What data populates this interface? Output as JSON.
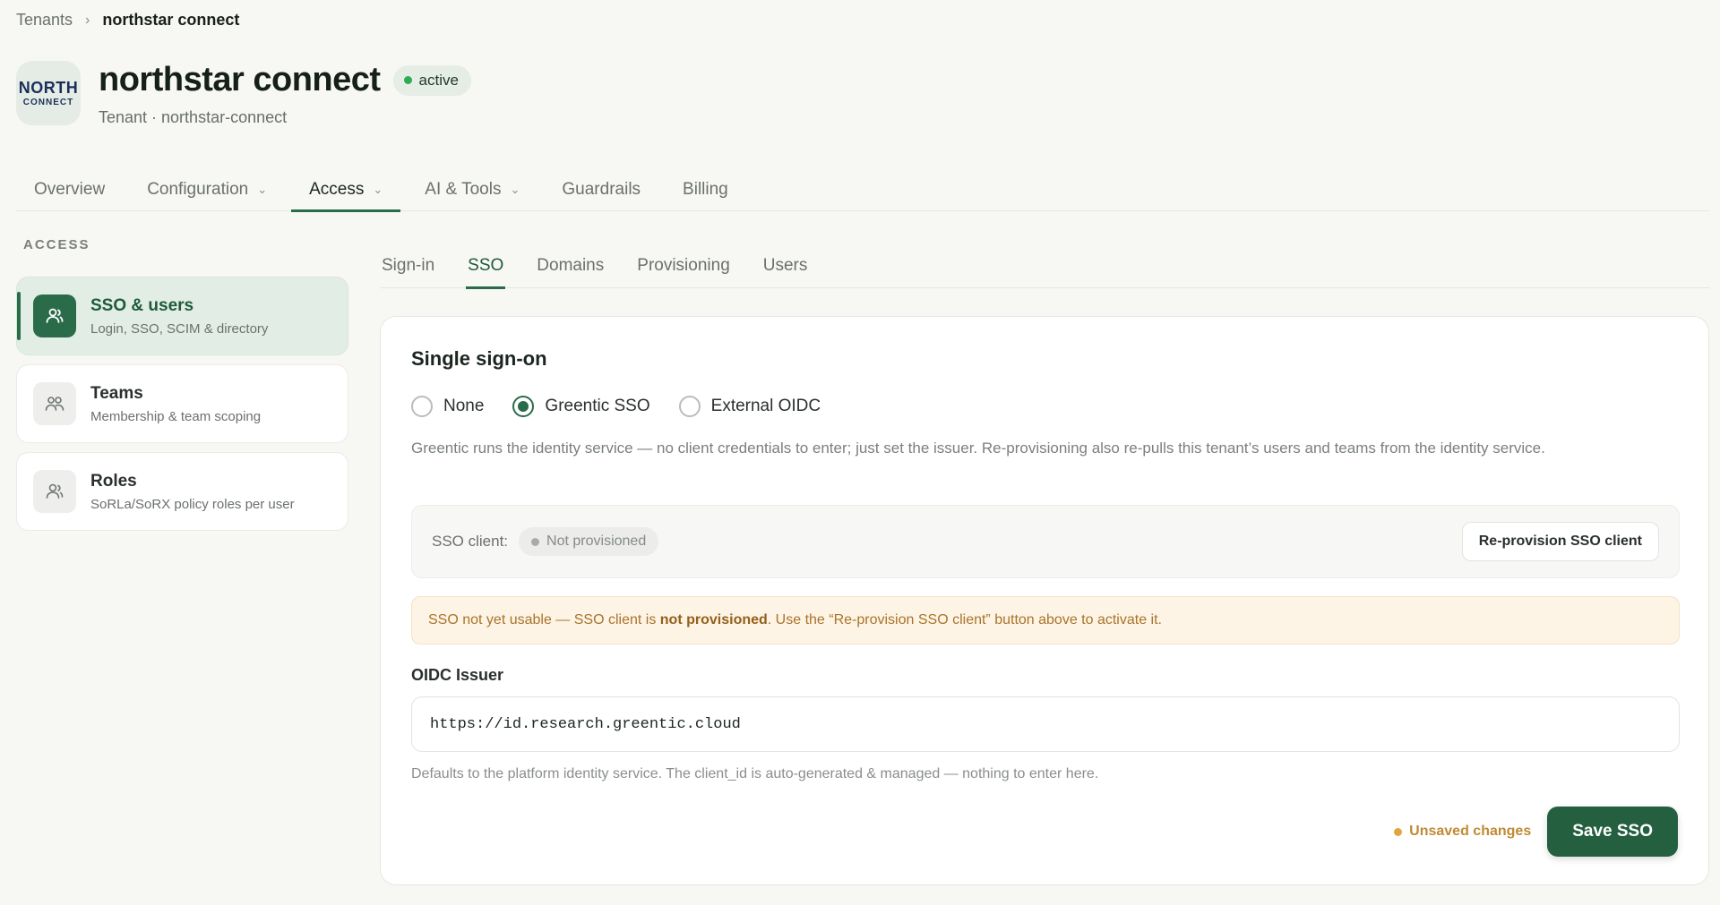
{
  "breadcrumb": {
    "parent": "Tenants",
    "separator": "›",
    "current": "northstar connect"
  },
  "tenant": {
    "logo_line1": "NORTH",
    "logo_line2": "CONNECT",
    "name": "northstar connect",
    "status": "active",
    "subtitle": "Tenant · northstar-connect"
  },
  "main_tabs": [
    {
      "label": "Overview"
    },
    {
      "label": "Configuration"
    },
    {
      "label": "Access"
    },
    {
      "label": "AI & Tools"
    },
    {
      "label": "Guardrails"
    },
    {
      "label": "Billing"
    }
  ],
  "sidebar": {
    "section_label": "ACCESS",
    "items": [
      {
        "title": "SSO & users",
        "desc": "Login, SSO, SCIM & directory",
        "icon": "user-icon"
      },
      {
        "title": "Teams",
        "desc": "Membership & team scoping",
        "icon": "users-icon"
      },
      {
        "title": "Roles",
        "desc": "SoRLa/SoRX policy roles per user",
        "icon": "user-role-icon"
      }
    ]
  },
  "sub_tabs": [
    {
      "label": "Sign-in"
    },
    {
      "label": "SSO"
    },
    {
      "label": "Domains"
    },
    {
      "label": "Provisioning"
    },
    {
      "label": "Users"
    }
  ],
  "sso": {
    "title": "Single sign-on",
    "options": [
      {
        "label": "None",
        "checked": false
      },
      {
        "label": "Greentic SSO",
        "checked": true
      },
      {
        "label": "External OIDC",
        "checked": false
      }
    ],
    "description": "Greentic runs the identity service — no client credentials to enter; just set the issuer. Re-provisioning also re-pulls this tenant’s users and teams from the identity service.",
    "client_label": "SSO client:",
    "client_status": "Not provisioned",
    "reprovision_label": "Re-provision SSO client",
    "alert_pre": "SSO not yet usable — SSO client is ",
    "alert_bold": "not provisioned",
    "alert_post": ". Use the “Re-provision SSO client” button above to activate it.",
    "issuer_label": "OIDC Issuer",
    "issuer_value": "https://id.research.greentic.cloud",
    "help": "Defaults to the platform identity service. The client_id is auto-generated & managed — nothing to enter here.",
    "unsaved_label": "Unsaved changes",
    "save_label": "Save SSO"
  },
  "colors": {
    "accent": "#2a6b4a",
    "active_badge": "#2faa55",
    "warning": "#c08a34"
  }
}
